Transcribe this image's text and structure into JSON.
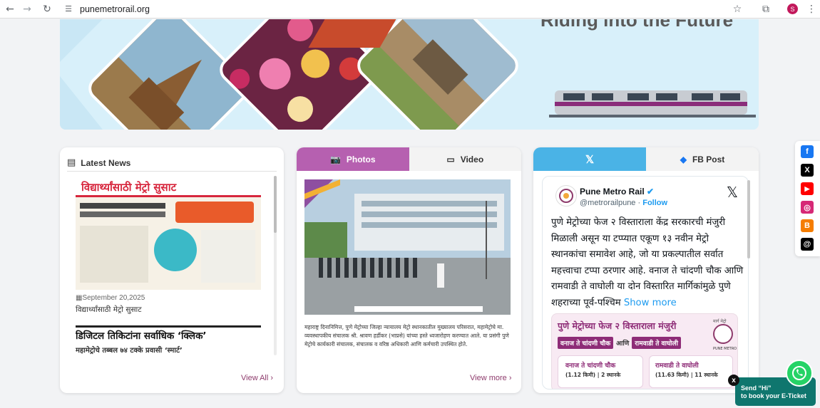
{
  "browser": {
    "url": "punemetrorail.org",
    "avatar_letter": "S",
    "icons": [
      "back-icon",
      "forward-icon",
      "reload-icon",
      "site-settings-icon",
      "bookmark-star-icon",
      "extensions-icon",
      "profile-avatar"
    ]
  },
  "banner": {
    "tagline": "Riding into the Future"
  },
  "news": {
    "heading": "Latest News",
    "items": [
      {
        "headline_in_image": "विद्यार्थ्यांसाठी मेट्रो सुसाट",
        "date": "September 20,2025",
        "title": "विद्यार्थ्यांसाठी मेट्रो सुसाट"
      },
      {
        "headline_in_image": "डिजिटल तिकिटांना सर्वाधिक ‘क्लिक’",
        "subline_in_image": "महामेट्रोचे तब्बल ७४ टक्के प्रवासी ‘स्मार्ट’"
      }
    ],
    "view_all": "View All"
  },
  "media": {
    "tabs": [
      {
        "label": "Photos",
        "icon": "camera-icon",
        "active": true
      },
      {
        "label": "Video",
        "icon": "video-icon",
        "active": false
      }
    ],
    "caption": "महाराष्ट्र दिनानिमित्त, पुणे मेट्रोच्या जिल्हा न्यायालय मेट्रो स्थानकातील मुख्यालय परिसरात, महामेट्रोचे मा. व्यवस्थापकीय संचालक श्री. श्रावण हर्डीकर (भाप्रसे) यांच्या हस्ते ध्वजारोहण करण्यात आले. या प्रसंगी पुणे मेट्रोचे कार्यकारी संचालक, संचालक व वरिष्ठ अधिकारी आणि कर्मचारी उपस्थित होते.",
    "view_more": "View more"
  },
  "social_feed": {
    "tabs": [
      {
        "label": "",
        "icon": "x-logo-icon",
        "active": true
      },
      {
        "label": "FB Post",
        "icon": "fb-post-icon",
        "active": false
      }
    ],
    "tweet": {
      "name": "Pune Metro Rail",
      "handle": "@metrorailpune",
      "follow": "Follow",
      "text": "पुणे मेट्रोच्या फेज २ विस्ताराला केंद्र सरकारची मंजुरी मिळाली असून या टप्प्यात एकूण १३ नवीन मेट्रो स्थानकांचा समावेश आहे, जो या प्रकल्पातील सर्वात महत्त्वाचा टप्पा ठरणार आहे. वनाज ते चांदणी चौक आणि रामवाडी ते वाघोली या दोन विस्तारित मार्गिकांमुळे पुणे शहराच्या पूर्व-पश्चिम",
      "show_more": "Show more",
      "image": {
        "title": "पुणे मेट्रोच्या फेज २ विस्ताराला मंजुरी",
        "route1": "वनाज ते चांदणी चौक",
        "and": "आणि",
        "route2": "रामवाडी ते वाघोली",
        "box1_title": "वनाज ते चांदणी चौक",
        "box1_sub": "(1.12 किमी) | 2 स्थानके",
        "box2_title": "रामवाडी ते वाघोली",
        "box2_sub": "(11.63 किमी) | 11 स्थानके",
        "logo_text": "PUNE METRO",
        "badge": "मार्ग मेट्रो"
      }
    }
  },
  "social_bar": [
    {
      "icon": "facebook-icon",
      "color": "#1877f2",
      "glyph": "f"
    },
    {
      "icon": "x-icon",
      "color": "#000000",
      "glyph": "X"
    },
    {
      "icon": "youtube-icon",
      "color": "#ff0000",
      "glyph": "▶"
    },
    {
      "icon": "instagram-icon",
      "color": "#d62976",
      "glyph": "◎"
    },
    {
      "icon": "blogger-icon",
      "color": "#f57d00",
      "glyph": "B"
    },
    {
      "icon": "threads-icon",
      "color": "#000000",
      "glyph": "@"
    }
  ],
  "whatsapp": {
    "line1": "Send “Hi”",
    "line2": "to book your E-Ticket",
    "close": "x"
  },
  "colors": {
    "accent_purple": "#b660b0",
    "tab_blue": "#4ab3e6",
    "link_purple": "#8e3b6c",
    "twitter_blue": "#1d9bf0",
    "whatsapp_green": "#25d366",
    "whatsapp_bar": "#0f766e"
  }
}
